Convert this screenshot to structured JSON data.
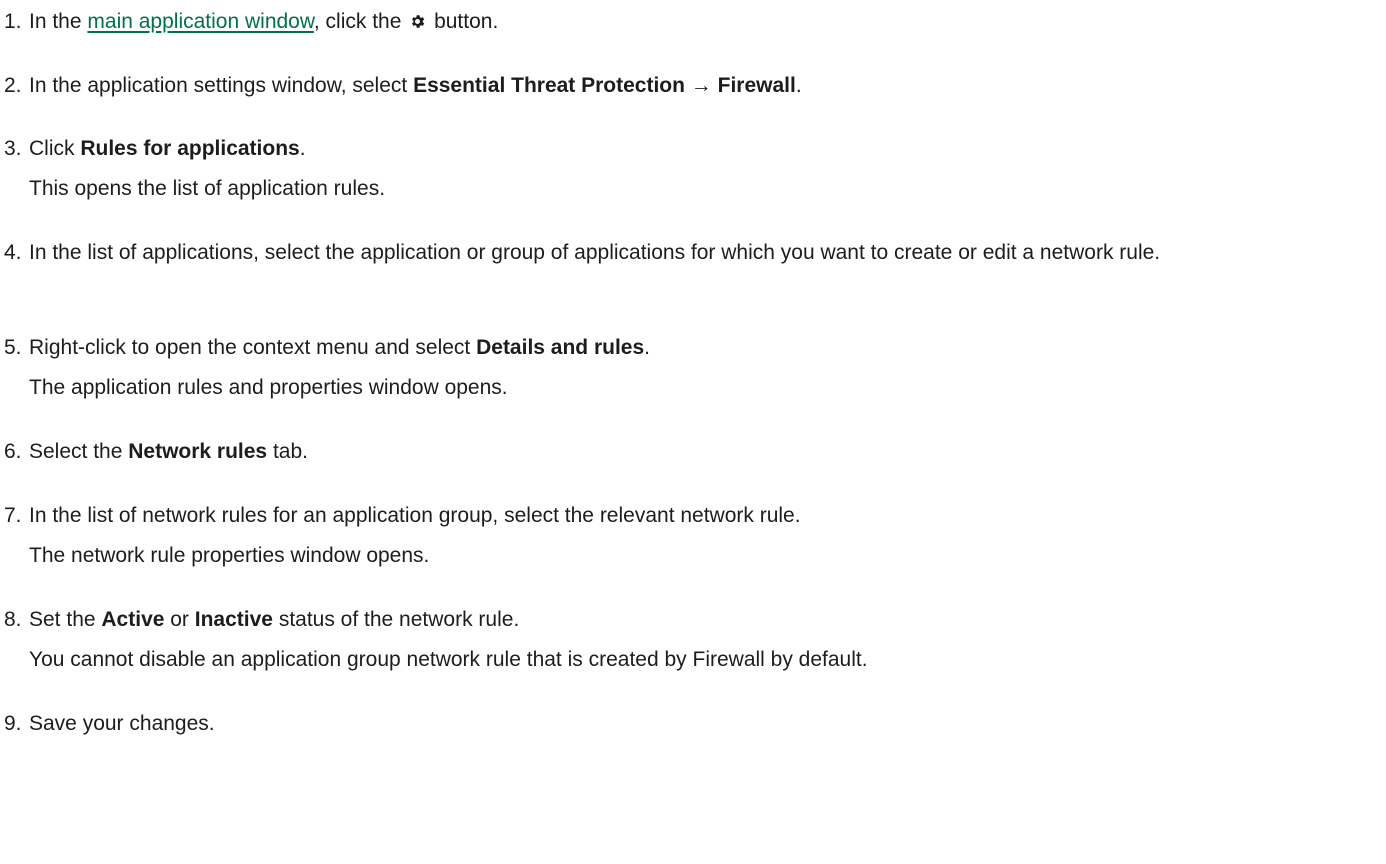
{
  "steps": [
    {
      "number": "1.",
      "before_link": "In the ",
      "link_text": "main application window",
      "after_link": ", click the ",
      "icon": "gear-icon",
      "after_icon": " button."
    },
    {
      "number": "2.",
      "text_before": "In the application settings window, select ",
      "bold_1": "Essential Threat Protection",
      "arrow": " → ",
      "bold_2": "Firewall",
      "text_after": "."
    },
    {
      "number": "3.",
      "text_before": "Click ",
      "bold_1": "Rules for applications",
      "text_after": ".",
      "note": "This opens the list of application rules."
    },
    {
      "number": "4.",
      "text": "In the list of applications, select the application or group of applications for which you want to create or edit a network rule."
    },
    {
      "number": "5.",
      "text_before": "Right-click to open the context menu and select ",
      "bold_1": "Details and rules",
      "text_after": ".",
      "note": "The application rules and properties window opens."
    },
    {
      "number": "6.",
      "text_before": "Select the ",
      "bold_1": "Network rules",
      "text_after": " tab."
    },
    {
      "number": "7.",
      "text": "In the list of network rules for an application group, select the relevant network rule.",
      "note": "The network rule properties window opens."
    },
    {
      "number": "8.",
      "text_before": "Set the ",
      "bold_1": "Active",
      "text_mid": " or ",
      "bold_2": "Inactive",
      "text_after": " status of the network rule.",
      "note": "You cannot disable an application group network rule that is created by Firewall by default."
    },
    {
      "number": "9.",
      "text": "Save your changes."
    }
  ]
}
